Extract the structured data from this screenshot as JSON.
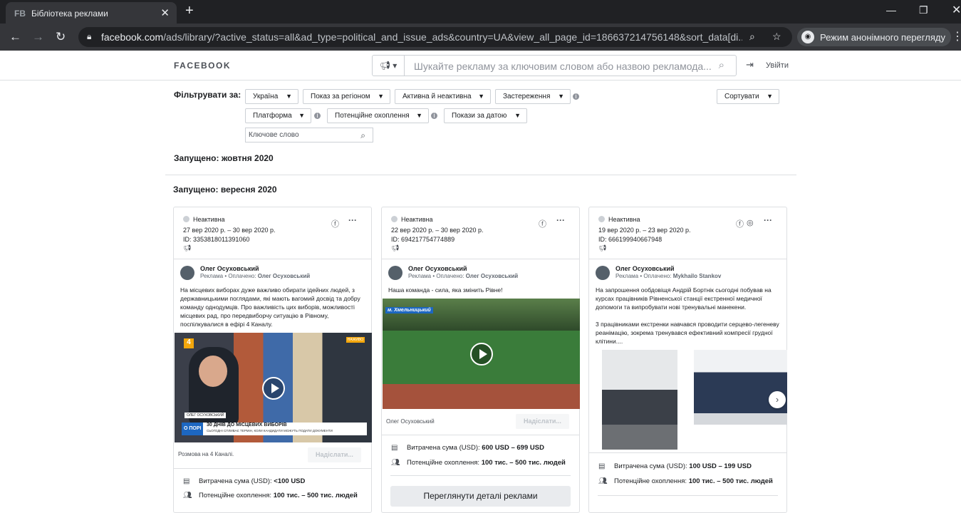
{
  "browser": {
    "tab_favicon": "FB",
    "tab_title": "Бібліотека реклами",
    "url_host": "facebook.com",
    "url_path": "/ads/library/?active_status=all&ad_type=political_and_issue_ads&country=UA&view_all_page_id=186637214756148&sort_data[di...",
    "incognito_label": "Режим анонімного перегляду"
  },
  "header": {
    "logo": "FACEBOOK",
    "search_placeholder": "Шукайте рекламу за ключовим словом або назвою рекламода...",
    "logout": "Увійти"
  },
  "filters": {
    "label": "Фільтрувати за:",
    "country": "Україна",
    "region": "Показ за регіоном",
    "status": "Активна й неактивна",
    "disclaimer": "Застереження",
    "sort": "Сортувати",
    "platform": "Платформа",
    "reach": "Потенційне охоплення",
    "dates": "Покази за датою",
    "keyword_placeholder": "Ключове слово"
  },
  "sections": {
    "october": "Запущено: жовтня 2020",
    "september": "Запущено: вересня 2020"
  },
  "cards": [
    {
      "status": "Неактивна",
      "dates": "27 вер 2020 р. – 30 вер 2020 р.",
      "id": "ID: 3353818011391060",
      "advertiser": "Олег Осуховський",
      "sponsored_prefix": "Реклама • Оплачено:",
      "paid_by": "Олег Осуховський",
      "text": "На місцевих виборах дуже важливо обирати ідейних людей, з державницькими поглядами, які мають вагомий досвід та добру команду однодумців. Про важливість цих виборів, можливості місцевих рад, про передвиборчу ситуацію в Рівному, поспілкувалися в ефірі 4 Каналу.",
      "caption": "Розмова на 4 Каналі.",
      "send": "Надіслати...",
      "spend_label": "Витрачена сума (USD):",
      "spend": "<100 USD",
      "reach_label": "Потенційне охоплення:",
      "reach": "100 тис. – 500 тис. людей",
      "tv": {
        "channel": "4",
        "live": "НАЖИВО",
        "name": "ОЛЕГ ОСУХОВСЬКИЙ",
        "tag": "О ПОРІ",
        "headline": "30 ДНІВ ДО МІСЦЕВИХ ВИБОРІВ",
        "subhead": "СЬОГОДНІ СПЛИВАЄ ТЕРМІН, КОЛИ КАНДИДАТИ МОЖУТЬ ПОДАТИ ДОКУМЕНТИ"
      }
    },
    {
      "status": "Неактивна",
      "dates": "22 вер 2020 р. – 30 вер 2020 р.",
      "id": "ID: 694217754774889",
      "advertiser": "Олег Осуховський",
      "sponsored_prefix": "Реклама • Оплачено:",
      "paid_by": "Олег Осуховський",
      "text": "Наша команда - сила, яка змінить Рівне!",
      "video_label": "м. Хмельницький",
      "caption": "Олег Осуховський",
      "send": "Надіслати...",
      "spend_label": "Витрачена сума (USD):",
      "spend": "600 USD – 699 USD",
      "reach_label": "Потенційне охоплення:",
      "reach": "100 тис. – 500 тис. людей",
      "details": "Переглянути деталі реклами"
    },
    {
      "status": "Неактивна",
      "dates": "19 вер 2020 р. – 23 вер 2020 р.",
      "id": "ID: 666199940667948",
      "advertiser": "Олег Осуховський",
      "sponsored_prefix": "Реклама • Оплачено:",
      "paid_by": "Mykhailo Stankov",
      "text": "На запрошення ообдовіщя Андрій Бортнік сьогодні побував на курсах працівників Рівненської станції екстренної медичної допомоги та випробувати нові тренувальні манекени.\n\n3 працівниками екстренки навчався проводити серцево-легеневу реанімацію, зокрема тренувався ефективний компресії грудної клітини....",
      "spend_label": "Витрачена сума (USD):",
      "spend": "100 USD – 199 USD",
      "reach_label": "Потенційне охоплення:",
      "reach": "100 тис. – 500 тис. людей"
    }
  ]
}
